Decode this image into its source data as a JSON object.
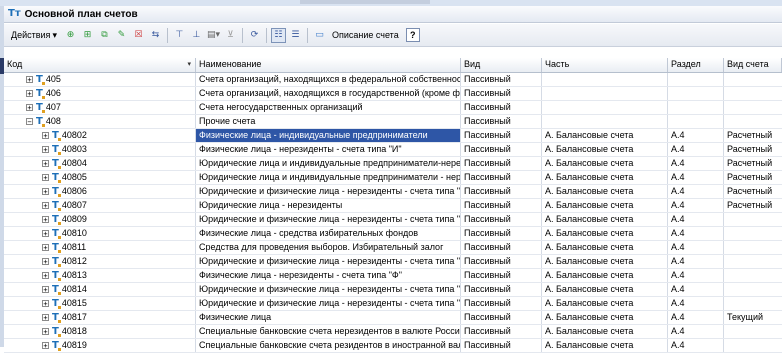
{
  "window": {
    "title": "Основной план счетов"
  },
  "toolbar": {
    "actions_label": "Действия",
    "actions_arrow": "▾",
    "description_label": "Описание счета",
    "help_label": "?"
  },
  "columns": {
    "code": "Код",
    "name": "Наименование",
    "kind": "Вид",
    "part": "Часть",
    "section": "Раздел",
    "account_type": "Вид счета"
  },
  "rows": [
    {
      "code": "405",
      "name": "Счета организаций, находящихся в федеральной собственности",
      "kind": "Пассивный",
      "part": "",
      "section": "",
      "type": "",
      "level": 0,
      "sign": "+"
    },
    {
      "code": "406",
      "name": "Счета организаций, находящихся в государственной (кроме фе...",
      "kind": "Пассивный",
      "part": "",
      "section": "",
      "type": "",
      "level": 0,
      "sign": "+"
    },
    {
      "code": "407",
      "name": "Счета негосударственных организаций",
      "kind": "Пассивный",
      "part": "",
      "section": "",
      "type": "",
      "level": 0,
      "sign": "+"
    },
    {
      "code": "408",
      "name": "Прочие счета",
      "kind": "Пассивный",
      "part": "",
      "section": "",
      "type": "",
      "level": 0,
      "sign": "−"
    },
    {
      "code": "40802",
      "name": "Физические лица - индивидуальные предприниматели",
      "kind": "Пассивный",
      "part": "А. Балансовые счета",
      "section": "А.4",
      "type": "Расчетный",
      "level": 1,
      "sign": "+",
      "selected": true
    },
    {
      "code": "40803",
      "name": "Физические лица - нерезиденты - счета типа \"И\"",
      "kind": "Пассивный",
      "part": "А. Балансовые счета",
      "section": "А.4",
      "type": "Расчетный",
      "level": 1,
      "sign": "+"
    },
    {
      "code": "40804",
      "name": "Юридические лица и индивидуальные предприниматели-нерези...",
      "kind": "Пассивный",
      "part": "А. Балансовые счета",
      "section": "А.4",
      "type": "Расчетный",
      "level": 1,
      "sign": "+"
    },
    {
      "code": "40805",
      "name": "Юридические лица и индивидуальные предприниматели - нерез...",
      "kind": "Пассивный",
      "part": "А. Балансовые счета",
      "section": "А.4",
      "type": "Расчетный",
      "level": 1,
      "sign": "+"
    },
    {
      "code": "40806",
      "name": "Юридические и физические лица - нерезиденты - счета типа \"С\"...",
      "kind": "Пассивный",
      "part": "А. Балансовые счета",
      "section": "А.4",
      "type": "Расчетный",
      "level": 1,
      "sign": "+"
    },
    {
      "code": "40807",
      "name": "Юридические лица - нерезиденты",
      "kind": "Пассивный",
      "part": "А. Балансовые счета",
      "section": "А.4",
      "type": "Расчетный",
      "level": 1,
      "sign": "+"
    },
    {
      "code": "40809",
      "name": "Юридические и физические лица - нерезиденты - счета типа \"С\"...",
      "kind": "Пассивный",
      "part": "А. Балансовые счета",
      "section": "А.4",
      "type": "",
      "level": 1,
      "sign": "+"
    },
    {
      "code": "40810",
      "name": "Физические лица - средства избирательных фондов",
      "kind": "Пассивный",
      "part": "А. Балансовые счета",
      "section": "А.4",
      "type": "",
      "level": 1,
      "sign": "+"
    },
    {
      "code": "40811",
      "name": "Средства для проведения выборов. Избирательный залог",
      "kind": "Пассивный",
      "part": "А. Балансовые счета",
      "section": "А.4",
      "type": "",
      "level": 1,
      "sign": "+"
    },
    {
      "code": "40812",
      "name": "Юридические и физические лица - нерезиденты - счета типа \"С\"...",
      "kind": "Пассивный",
      "part": "А. Балансовые счета",
      "section": "А.4",
      "type": "",
      "level": 1,
      "sign": "+"
    },
    {
      "code": "40813",
      "name": "Физические лица - нерезиденты - счета типа \"Ф\"",
      "kind": "Пассивный",
      "part": "А. Балансовые счета",
      "section": "А.4",
      "type": "",
      "level": 1,
      "sign": "+"
    },
    {
      "code": "40814",
      "name": "Юридические и физические лица - нерезиденты - счета типа \"К\"...",
      "kind": "Пассивный",
      "part": "А. Балансовые счета",
      "section": "А.4",
      "type": "",
      "level": 1,
      "sign": "+"
    },
    {
      "code": "40815",
      "name": "Юридические и физические лица - нерезиденты - счета типа \"Н\"...",
      "kind": "Пассивный",
      "part": "А. Балансовые счета",
      "section": "А.4",
      "type": "",
      "level": 1,
      "sign": "+"
    },
    {
      "code": "40817",
      "name": "Физические лица",
      "kind": "Пассивный",
      "part": "А. Балансовые счета",
      "section": "А.4",
      "type": "Текущий",
      "level": 1,
      "sign": "+"
    },
    {
      "code": "40818",
      "name": "Специальные банковские счета нерезидентов в валюте Российск...",
      "kind": "Пассивный",
      "part": "А. Балансовые счета",
      "section": "А.4",
      "type": "",
      "level": 1,
      "sign": "+"
    },
    {
      "code": "40819",
      "name": "Специальные банковские счета резидентов в иностранной вал...",
      "kind": "Пассивный",
      "part": "А. Балансовые счета",
      "section": "А.4",
      "type": "",
      "level": 1,
      "sign": "+"
    }
  ],
  "icons": {
    "tree_account": "T-account-icon",
    "sort_arrow": "▾"
  },
  "colors": {
    "selection": "#2e56a6",
    "account_icon": "#1d6fb8"
  }
}
